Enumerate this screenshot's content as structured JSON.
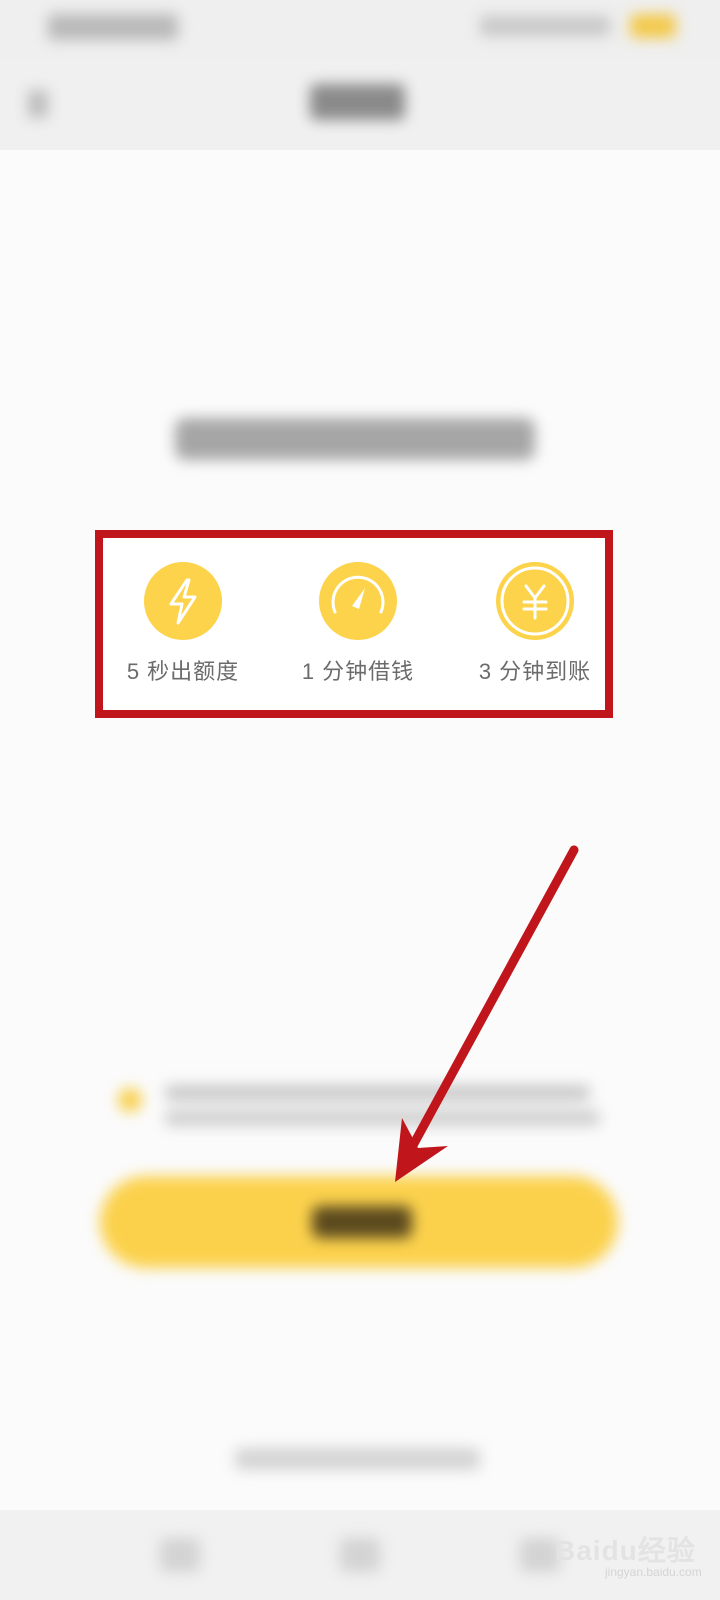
{
  "features": [
    {
      "icon": "lightning-icon",
      "label": "5 秒出额度"
    },
    {
      "icon": "speedometer-icon",
      "label": "1 分钟借钱"
    },
    {
      "icon": "yuan-icon",
      "label": "3 分钟到账"
    }
  ],
  "watermark": {
    "brand": "Baidu经验",
    "sub": "jingyan.baidu.com"
  },
  "colors": {
    "accent": "#fcd34a",
    "annotation_red": "#c0151a",
    "label_gray": "#6b6b6b"
  }
}
